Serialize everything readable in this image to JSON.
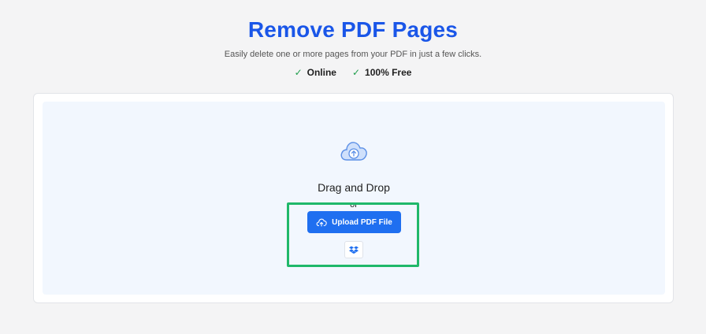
{
  "header": {
    "title": "Remove PDF Pages",
    "subtitle": "Easily delete one or more pages from your PDF in just a few clicks.",
    "features": [
      {
        "check_icon": "check-icon",
        "label": "Online"
      },
      {
        "check_icon": "check-icon",
        "label": "100% Free"
      }
    ]
  },
  "upload": {
    "icon": "cloud-upload-icon",
    "drag_text": "Drag and Drop",
    "or_text": "or",
    "button_label": "Upload PDF File",
    "button_icon": "cloud-upload-icon",
    "dropbox_icon": "dropbox-icon"
  },
  "colors": {
    "accent": "#1a56e8",
    "button": "#1f6ff0",
    "check": "#1f9d4c",
    "highlight": "#20b86a",
    "dropzone_bg": "#f2f7fe"
  }
}
